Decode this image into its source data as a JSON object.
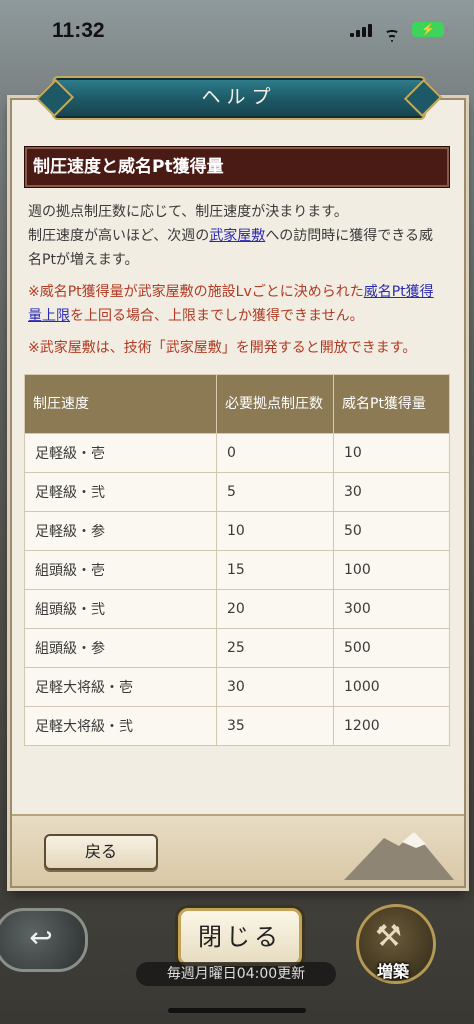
{
  "status": {
    "time": "11:32",
    "battery": "⚡"
  },
  "dialog": {
    "title": "ヘルプ",
    "section_title": "制圧速度と威名Pt獲得量",
    "para1_line1": "週の拠点制圧数に応じて、制圧速度が決まります。",
    "para1_pre": "制圧速度が高いほど、次週の",
    "para1_link": "武家屋敷",
    "para1_post": "への訪問時に獲得できる威名Ptが増えます。",
    "note1_pre": "※威名Pt獲得量が武家屋敷の施設Lvごとに決められた",
    "note1_link": "威名Pt獲得量上限",
    "note1_post": "を上回る場合、上限までしか獲得できません。",
    "note2": "※武家屋敷は、技術「武家屋敷」を開発すると開放できます。",
    "table": {
      "headers": [
        "制圧速度",
        "必要拠点制圧数",
        "威名Pt獲得量"
      ],
      "rows": [
        [
          "足軽級・壱",
          "0",
          "10"
        ],
        [
          "足軽級・弐",
          "5",
          "30"
        ],
        [
          "足軽級・参",
          "10",
          "50"
        ],
        [
          "組頭級・壱",
          "15",
          "100"
        ],
        [
          "組頭級・弐",
          "20",
          "300"
        ],
        [
          "組頭級・参",
          "25",
          "500"
        ],
        [
          "足軽大将級・壱",
          "30",
          "1000"
        ],
        [
          "足軽大将級・弐",
          "35",
          "1200"
        ]
      ]
    },
    "back_label": "戻る"
  },
  "bottom": {
    "close_label": "閉じる",
    "weekly_text": "毎週月曜日04:00更新",
    "build_label": "増築"
  }
}
